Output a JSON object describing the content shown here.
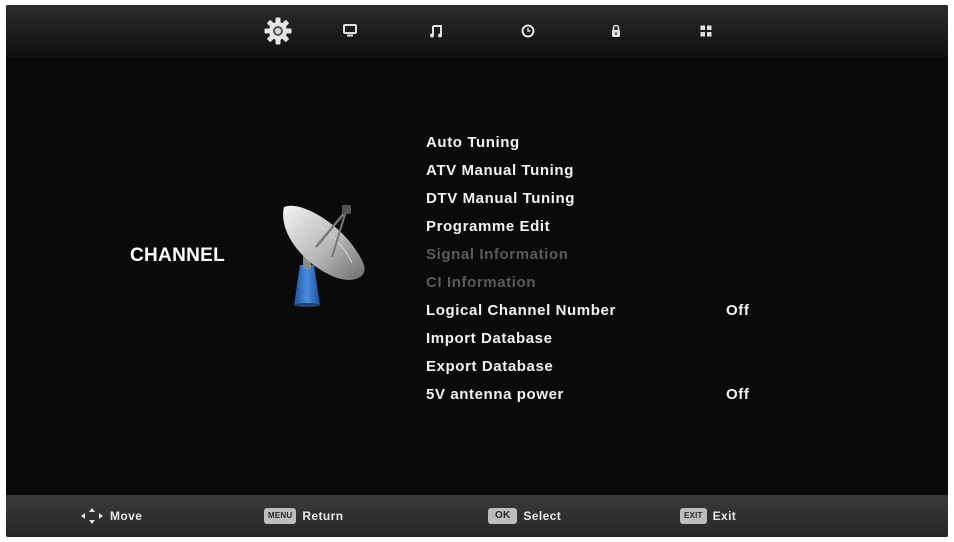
{
  "tabs": [
    {
      "icon": "gear-icon",
      "active": true
    },
    {
      "icon": "monitor-icon",
      "active": false
    },
    {
      "icon": "music-note-icon",
      "active": false
    },
    {
      "icon": "clock-icon",
      "active": false
    },
    {
      "icon": "lock-icon",
      "active": false
    },
    {
      "icon": "grid-icon",
      "active": false
    }
  ],
  "section": {
    "title": "CHANNEL",
    "icon": "satellite-dish-icon"
  },
  "menu": {
    "items": [
      {
        "label": "Auto Tuning",
        "value": "",
        "enabled": true
      },
      {
        "label": "ATV Manual Tuning",
        "value": "",
        "enabled": true
      },
      {
        "label": "DTV Manual Tuning",
        "value": "",
        "enabled": true
      },
      {
        "label": "Programme Edit",
        "value": "",
        "enabled": true
      },
      {
        "label": "Signal Information",
        "value": "",
        "enabled": false
      },
      {
        "label": "CI Information",
        "value": "",
        "enabled": false
      },
      {
        "label": "Logical Channel Number",
        "value": "Off",
        "enabled": true
      },
      {
        "label": "Import Database",
        "value": "",
        "enabled": true
      },
      {
        "label": "Export Database",
        "value": "",
        "enabled": true
      },
      {
        "label": "5V antenna power",
        "value": "Off",
        "enabled": true
      }
    ]
  },
  "footer": {
    "move": {
      "label": "Move",
      "icon": "dpad-arrows-icon"
    },
    "return": {
      "key": "MENU",
      "label": "Return"
    },
    "select": {
      "key": "OK",
      "label": "Select"
    },
    "exit": {
      "key": "EXIT",
      "label": "Exit"
    }
  },
  "colors": {
    "background": "#000000",
    "text": "#f2f2f2",
    "disabled": "#5a5a5a",
    "accent_dish": "#3a78c8"
  }
}
